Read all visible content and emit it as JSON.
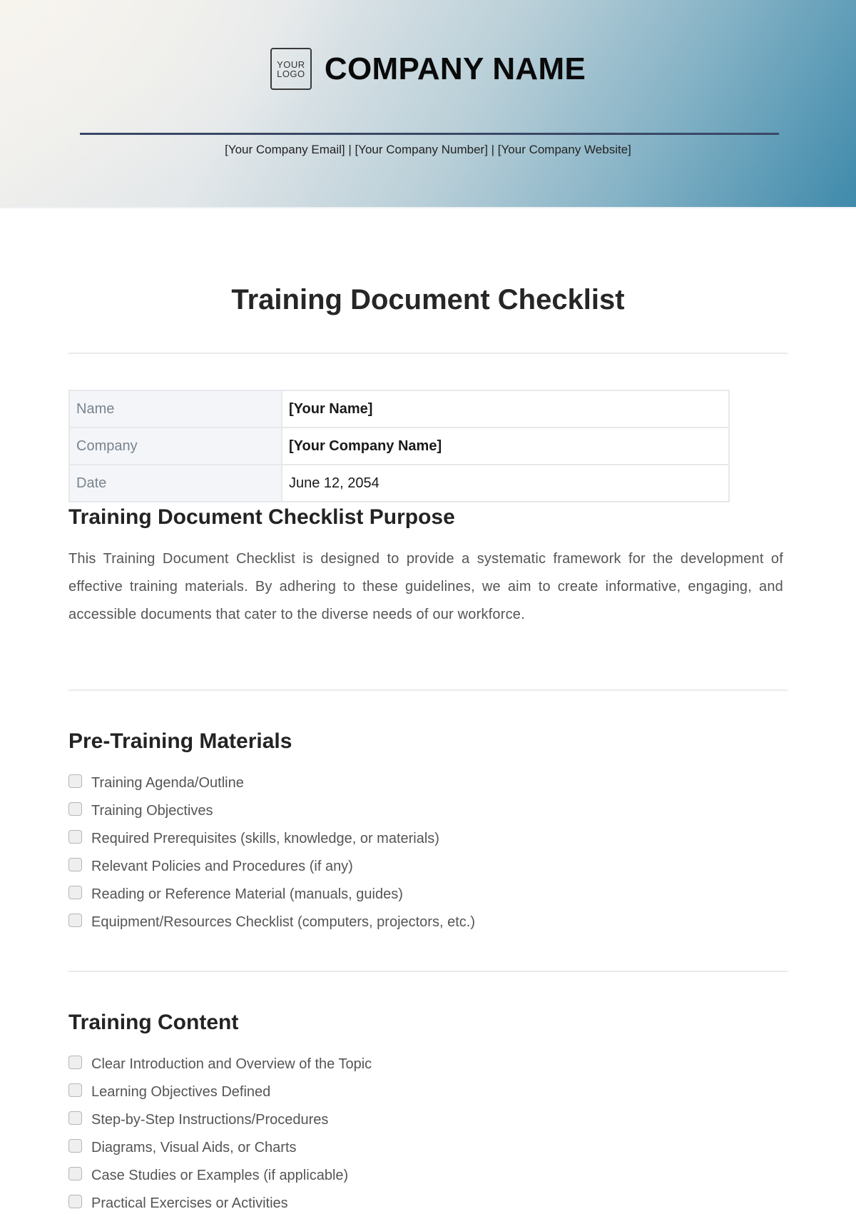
{
  "header": {
    "logo_line1": "YOUR",
    "logo_line2": "LOGO",
    "company_name": "COMPANY NAME",
    "contact": "[Your Company Email] | [Your Company Number] | [Your Company Website]",
    "gradient_colors": [
      "#f4f2ee",
      "#b9cfd8",
      "#3f8aab"
    ],
    "rule_color": "#3a4866"
  },
  "document": {
    "title": "Training Document Checklist"
  },
  "info_table": [
    {
      "label": "Name",
      "value": "[Your Name]"
    },
    {
      "label": "Company",
      "value": "[Your Company Name]"
    },
    {
      "label": "Date",
      "value": "June 12, 2054"
    }
  ],
  "purpose": {
    "heading": "Training Document Checklist Purpose",
    "body": "This Training Document Checklist is designed to provide a systematic framework for the development of effective training materials. By adhering to these guidelines, we aim to create informative, engaging, and accessible documents that cater to the diverse needs of our workforce."
  },
  "sections": [
    {
      "heading": "Pre-Training Materials",
      "items": [
        {
          "label": "Training Agenda/Outline",
          "checked": false
        },
        {
          "label": "Training Objectives",
          "checked": false
        },
        {
          "label": "Required Prerequisites (skills, knowledge, or materials)",
          "checked": false
        },
        {
          "label": "Relevant Policies and Procedures (if any)",
          "checked": false
        },
        {
          "label": "Reading or Reference Material (manuals, guides)",
          "checked": false
        },
        {
          "label": "Equipment/Resources Checklist (computers, projectors, etc.)",
          "checked": false
        }
      ]
    },
    {
      "heading": "Training Content",
      "items": [
        {
          "label": "Clear Introduction and Overview of the Topic",
          "checked": false
        },
        {
          "label": "Learning Objectives Defined",
          "checked": false
        },
        {
          "label": "Step-by-Step Instructions/Procedures",
          "checked": false
        },
        {
          "label": "Diagrams, Visual Aids, or Charts",
          "checked": false
        },
        {
          "label": "Case Studies or Examples (if applicable)",
          "checked": false
        },
        {
          "label": "Practical Exercises or Activities",
          "checked": false
        }
      ]
    }
  ]
}
